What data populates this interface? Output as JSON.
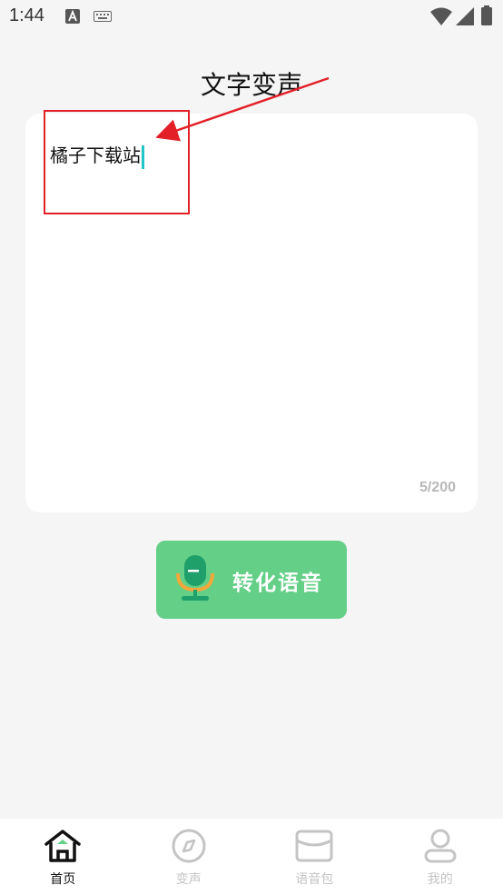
{
  "status_bar": {
    "time": "1:44"
  },
  "page": {
    "title": "文字变声"
  },
  "editor": {
    "text": "橘子下载站",
    "counter": "5/200"
  },
  "convert_button": {
    "label": "转化语音"
  },
  "tabs": [
    {
      "label": "首页",
      "icon": "home-icon",
      "active": true
    },
    {
      "label": "变声",
      "icon": "compass-icon",
      "active": false
    },
    {
      "label": "语音包",
      "icon": "package-icon",
      "active": false
    },
    {
      "label": "我的",
      "icon": "person-icon",
      "active": false
    }
  ],
  "colors": {
    "accent_green": "#63cf87",
    "annotation_red": "#e32028",
    "cursor": "#22c3c9",
    "background": "#f5f5f5"
  }
}
